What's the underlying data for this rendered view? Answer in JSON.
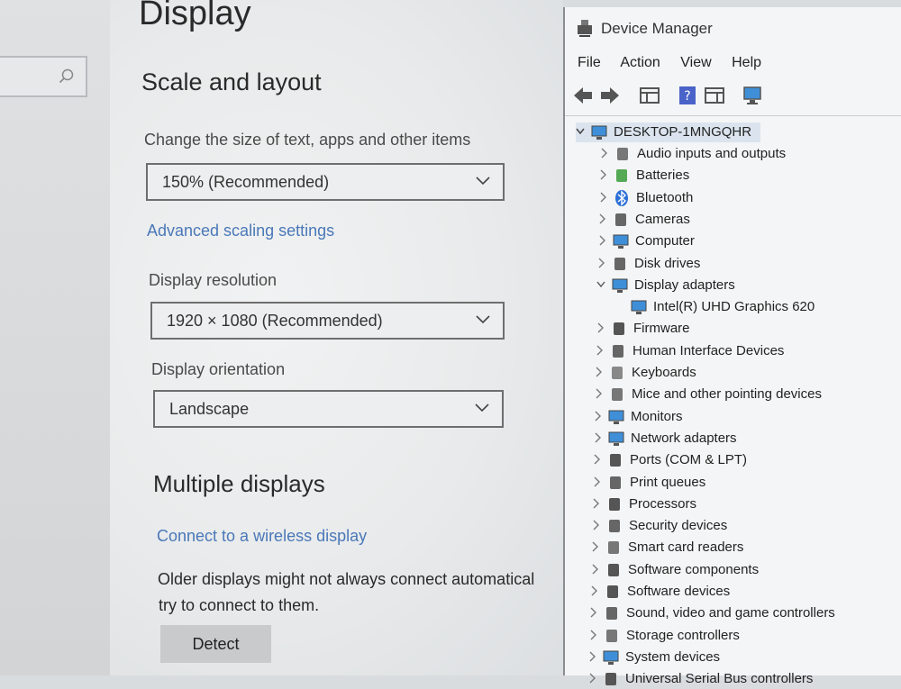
{
  "settings": {
    "page_title": "Display",
    "scale_section": "Scale and layout",
    "scale_label": "Change the size of text, apps and other items",
    "scale_value": "150% (Recommended)",
    "advanced_link": "Advanced scaling settings",
    "resolution_label": "Display resolution",
    "resolution_value": "1920 × 1080 (Recommended)",
    "orientation_label": "Display orientation",
    "orientation_value": "Landscape",
    "multi_section": "Multiple displays",
    "wireless_link": "Connect to a wireless display",
    "older_line1": "Older displays might not always connect automatical",
    "older_line2": "try to connect to them.",
    "detect_button": "Detect"
  },
  "device_manager": {
    "title": "Device Manager",
    "menu": [
      "File",
      "Action",
      "View",
      "Help"
    ],
    "root": "DESKTOP-1MNGQHR",
    "nodes": [
      {
        "label": "Audio inputs and outputs",
        "icon": "speaker-icon"
      },
      {
        "label": "Batteries",
        "icon": "battery-icon"
      },
      {
        "label": "Bluetooth",
        "icon": "bluetooth-icon"
      },
      {
        "label": "Cameras",
        "icon": "camera-icon"
      },
      {
        "label": "Computer",
        "icon": "computer-icon"
      },
      {
        "label": "Disk drives",
        "icon": "disk-icon"
      },
      {
        "label": "Display adapters",
        "icon": "display-adapter-icon",
        "expanded": true
      },
      {
        "label": "Intel(R) UHD Graphics 620",
        "icon": "display-adapter-icon",
        "child": true
      },
      {
        "label": "Firmware",
        "icon": "firmware-icon"
      },
      {
        "label": "Human Interface Devices",
        "icon": "hid-icon"
      },
      {
        "label": "Keyboards",
        "icon": "keyboard-icon"
      },
      {
        "label": "Mice and other pointing devices",
        "icon": "mouse-icon"
      },
      {
        "label": "Monitors",
        "icon": "monitor-icon"
      },
      {
        "label": "Network adapters",
        "icon": "network-icon"
      },
      {
        "label": "Ports (COM & LPT)",
        "icon": "port-icon"
      },
      {
        "label": "Print queues",
        "icon": "printer-icon"
      },
      {
        "label": "Processors",
        "icon": "processor-icon"
      },
      {
        "label": "Security devices",
        "icon": "security-icon"
      },
      {
        "label": "Smart card readers",
        "icon": "smartcard-icon"
      },
      {
        "label": "Software components",
        "icon": "software-component-icon"
      },
      {
        "label": "Software devices",
        "icon": "software-device-icon"
      },
      {
        "label": "Sound, video and game controllers",
        "icon": "sound-icon"
      },
      {
        "label": "Storage controllers",
        "icon": "storage-icon"
      },
      {
        "label": "System devices",
        "icon": "system-icon"
      },
      {
        "label": "Universal Serial Bus controllers",
        "icon": "usb-icon"
      }
    ]
  }
}
